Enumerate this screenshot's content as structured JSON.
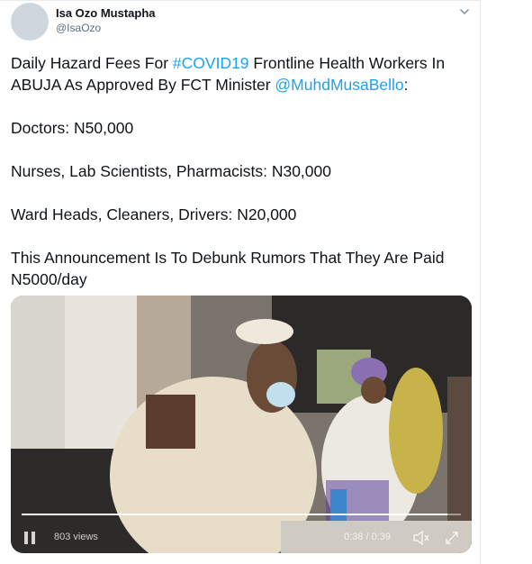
{
  "tweet": {
    "author": {
      "display_name": "Isa Ozo Mustapha",
      "handle": "@IsaOzo"
    },
    "text": {
      "line1_before": "Daily Hazard Fees For ",
      "hashtag": "#COVID19",
      "line1_after": " Frontline Health Workers In ABUJA As Approved By FCT Minister ",
      "mention": "@MuhdMusaBello",
      "line1_end": ":",
      "doctors": "Doctors: N50,000",
      "nurses": "Nurses, Lab Scientists, Pharmacists: N30,000",
      "ward": "Ward Heads, Cleaners, Drivers: N20,000",
      "announcement": "This Announcement Is To Debunk Rumors That They Are Paid N5000/day"
    },
    "video": {
      "views": "803 views",
      "time": "0:38 / 0:39",
      "progress": 0.97
    }
  },
  "colors": {
    "link": "#1da1f2",
    "text": "#0f1419",
    "secondary": "#5b7083"
  }
}
